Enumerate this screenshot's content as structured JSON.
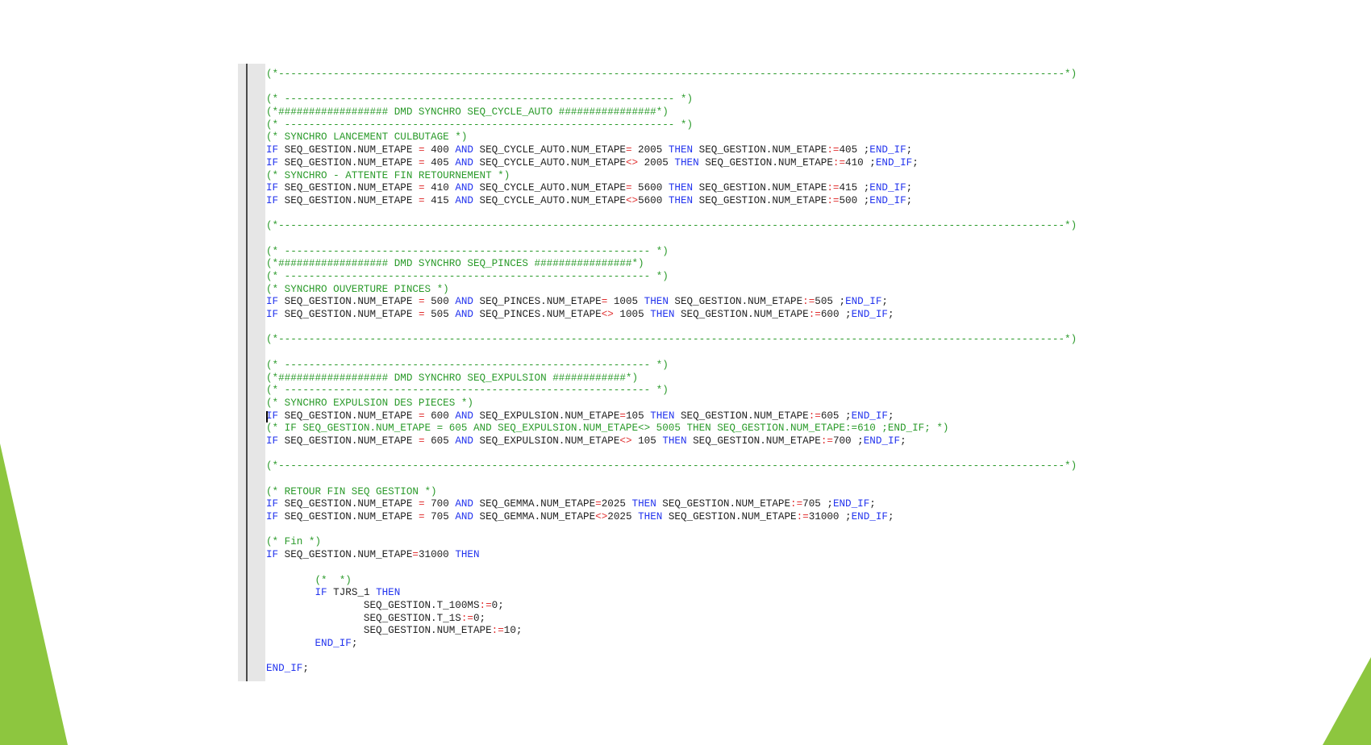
{
  "colors": {
    "comment": "#2a9a2a",
    "keyword": "#2233ee",
    "operator": "#e03030",
    "text": "#222222",
    "gutter": "#e6e6e6",
    "slide_accent_green": "#8dc63f"
  },
  "code_lines": [
    [
      [
        "cmt",
        "(*---------------------------------------------------------------------------------------------------------------------------------*)"
      ]
    ],
    [],
    [
      [
        "cmt",
        "(* ---------------------------------------------------------------- *)"
      ]
    ],
    [
      [
        "cmt",
        "(*################## DMD SYNCHRO SEQ_CYCLE_AUTO ################*)"
      ]
    ],
    [
      [
        "cmt",
        "(* ---------------------------------------------------------------- *)"
      ]
    ],
    [
      [
        "cmt",
        "(* SYNCHRO LANCEMENT CULBUTAGE *)"
      ]
    ],
    [
      [
        "kw",
        "IF"
      ],
      [
        "txt",
        " SEQ_GESTION.NUM_ETAPE "
      ],
      [
        "op",
        "="
      ],
      [
        "txt",
        " 400 "
      ],
      [
        "kw",
        "AND"
      ],
      [
        "txt",
        " SEQ_CYCLE_AUTO.NUM_ETAPE"
      ],
      [
        "op",
        "="
      ],
      [
        "txt",
        " 2005 "
      ],
      [
        "kw",
        "THEN"
      ],
      [
        "txt",
        " SEQ_GESTION.NUM_ETAPE"
      ],
      [
        "op",
        ":="
      ],
      [
        "txt",
        "405 ;"
      ],
      [
        "kw",
        "END_IF"
      ],
      [
        "txt",
        ";"
      ]
    ],
    [
      [
        "kw",
        "IF"
      ],
      [
        "txt",
        " SEQ_GESTION.NUM_ETAPE "
      ],
      [
        "op",
        "="
      ],
      [
        "txt",
        " 405 "
      ],
      [
        "kw",
        "AND"
      ],
      [
        "txt",
        " SEQ_CYCLE_AUTO.NUM_ETAPE"
      ],
      [
        "op",
        "<>"
      ],
      [
        "txt",
        " 2005 "
      ],
      [
        "kw",
        "THEN"
      ],
      [
        "txt",
        " SEQ_GESTION.NUM_ETAPE"
      ],
      [
        "op",
        ":="
      ],
      [
        "txt",
        "410 ;"
      ],
      [
        "kw",
        "END_IF"
      ],
      [
        "txt",
        ";"
      ]
    ],
    [
      [
        "cmt",
        "(* SYNCHRO - ATTENTE FIN RETOURNEMENT *)"
      ]
    ],
    [
      [
        "kw",
        "IF"
      ],
      [
        "txt",
        " SEQ_GESTION.NUM_ETAPE "
      ],
      [
        "op",
        "="
      ],
      [
        "txt",
        " 410 "
      ],
      [
        "kw",
        "AND"
      ],
      [
        "txt",
        " SEQ_CYCLE_AUTO.NUM_ETAPE"
      ],
      [
        "op",
        "="
      ],
      [
        "txt",
        " 5600 "
      ],
      [
        "kw",
        "THEN"
      ],
      [
        "txt",
        " SEQ_GESTION.NUM_ETAPE"
      ],
      [
        "op",
        ":="
      ],
      [
        "txt",
        "415 ;"
      ],
      [
        "kw",
        "END_IF"
      ],
      [
        "txt",
        ";"
      ]
    ],
    [
      [
        "kw",
        "IF"
      ],
      [
        "txt",
        " SEQ_GESTION.NUM_ETAPE "
      ],
      [
        "op",
        "="
      ],
      [
        "txt",
        " 415 "
      ],
      [
        "kw",
        "AND"
      ],
      [
        "txt",
        " SEQ_CYCLE_AUTO.NUM_ETAPE"
      ],
      [
        "op",
        "<>"
      ],
      [
        "txt",
        "5600 "
      ],
      [
        "kw",
        "THEN"
      ],
      [
        "txt",
        " SEQ_GESTION.NUM_ETAPE"
      ],
      [
        "op",
        ":="
      ],
      [
        "txt",
        "500 ;"
      ],
      [
        "kw",
        "END_IF"
      ],
      [
        "txt",
        ";"
      ]
    ],
    [],
    [
      [
        "cmt",
        "(*---------------------------------------------------------------------------------------------------------------------------------*)"
      ]
    ],
    [],
    [
      [
        "cmt",
        "(* ------------------------------------------------------------ *)"
      ]
    ],
    [
      [
        "cmt",
        "(*################## DMD SYNCHRO SEQ_PINCES ################*)"
      ]
    ],
    [
      [
        "cmt",
        "(* ------------------------------------------------------------ *)"
      ]
    ],
    [
      [
        "cmt",
        "(* SYNCHRO OUVERTURE PINCES *)"
      ]
    ],
    [
      [
        "kw",
        "IF"
      ],
      [
        "txt",
        " SEQ_GESTION.NUM_ETAPE "
      ],
      [
        "op",
        "="
      ],
      [
        "txt",
        " 500 "
      ],
      [
        "kw",
        "AND"
      ],
      [
        "txt",
        " SEQ_PINCES.NUM_ETAPE"
      ],
      [
        "op",
        "="
      ],
      [
        "txt",
        " 1005 "
      ],
      [
        "kw",
        "THEN"
      ],
      [
        "txt",
        " SEQ_GESTION.NUM_ETAPE"
      ],
      [
        "op",
        ":="
      ],
      [
        "txt",
        "505 ;"
      ],
      [
        "kw",
        "END_IF"
      ],
      [
        "txt",
        ";"
      ]
    ],
    [
      [
        "kw",
        "IF"
      ],
      [
        "txt",
        " SEQ_GESTION.NUM_ETAPE "
      ],
      [
        "op",
        "="
      ],
      [
        "txt",
        " 505 "
      ],
      [
        "kw",
        "AND"
      ],
      [
        "txt",
        " SEQ_PINCES.NUM_ETAPE"
      ],
      [
        "op",
        "<>"
      ],
      [
        "txt",
        " 1005 "
      ],
      [
        "kw",
        "THEN"
      ],
      [
        "txt",
        " SEQ_GESTION.NUM_ETAPE"
      ],
      [
        "op",
        ":="
      ],
      [
        "txt",
        "600 ;"
      ],
      [
        "kw",
        "END_IF"
      ],
      [
        "txt",
        ";"
      ]
    ],
    [],
    [
      [
        "cmt",
        "(*---------------------------------------------------------------------------------------------------------------------------------*)"
      ]
    ],
    [],
    [
      [
        "cmt",
        "(* ------------------------------------------------------------ *)"
      ]
    ],
    [
      [
        "cmt",
        "(*################## DMD SYNCHRO SEQ_EXPULSION ############*)"
      ]
    ],
    [
      [
        "cmt",
        "(* ------------------------------------------------------------ *)"
      ]
    ],
    [
      [
        "cmt",
        "(* SYNCHRO EXPULSION DES PIECES *)"
      ]
    ],
    [
      [
        "kw",
        "IF"
      ],
      [
        "txt",
        " SEQ_GESTION.NUM_ETAPE "
      ],
      [
        "op",
        "="
      ],
      [
        "txt",
        " 600 "
      ],
      [
        "kw",
        "AND"
      ],
      [
        "txt",
        " SEQ_EXPULSION.NUM_ETAPE"
      ],
      [
        "op",
        "="
      ],
      [
        "txt",
        "105 "
      ],
      [
        "kw",
        "THEN"
      ],
      [
        "txt",
        " SEQ_GESTION.NUM_ETAPE"
      ],
      [
        "op",
        ":="
      ],
      [
        "txt",
        "605 ;"
      ],
      [
        "kw",
        "END_IF"
      ],
      [
        "txt",
        ";"
      ]
    ],
    [
      [
        "cmt",
        "(* IF SEQ_GESTION.NUM_ETAPE = 605 AND SEQ_EXPULSION.NUM_ETAPE<> 5005 THEN SEQ_GESTION.NUM_ETAPE:=610 ;END_IF; *)"
      ]
    ],
    [
      [
        "kw",
        "IF"
      ],
      [
        "txt",
        " SEQ_GESTION.NUM_ETAPE "
      ],
      [
        "op",
        "="
      ],
      [
        "txt",
        " 605 "
      ],
      [
        "kw",
        "AND"
      ],
      [
        "txt",
        " SEQ_EXPULSION.NUM_ETAPE"
      ],
      [
        "op",
        "<>"
      ],
      [
        "txt",
        " 105 "
      ],
      [
        "kw",
        "THEN"
      ],
      [
        "txt",
        " SEQ_GESTION.NUM_ETAPE"
      ],
      [
        "op",
        ":="
      ],
      [
        "txt",
        "700 ;"
      ],
      [
        "kw",
        "END_IF"
      ],
      [
        "txt",
        ";"
      ]
    ],
    [],
    [
      [
        "cmt",
        "(*---------------------------------------------------------------------------------------------------------------------------------*)"
      ]
    ],
    [],
    [
      [
        "cmt",
        "(* RETOUR FIN SEQ GESTION *)"
      ]
    ],
    [
      [
        "kw",
        "IF"
      ],
      [
        "txt",
        " SEQ_GESTION.NUM_ETAPE "
      ],
      [
        "op",
        "="
      ],
      [
        "txt",
        " 700 "
      ],
      [
        "kw",
        "AND"
      ],
      [
        "txt",
        " SEQ_GEMMA.NUM_ETAPE"
      ],
      [
        "op",
        "="
      ],
      [
        "txt",
        "2025 "
      ],
      [
        "kw",
        "THEN"
      ],
      [
        "txt",
        " SEQ_GESTION.NUM_ETAPE"
      ],
      [
        "op",
        ":="
      ],
      [
        "txt",
        "705 ;"
      ],
      [
        "kw",
        "END_IF"
      ],
      [
        "txt",
        ";"
      ]
    ],
    [
      [
        "kw",
        "IF"
      ],
      [
        "txt",
        " SEQ_GESTION.NUM_ETAPE "
      ],
      [
        "op",
        "="
      ],
      [
        "txt",
        " 705 "
      ],
      [
        "kw",
        "AND"
      ],
      [
        "txt",
        " SEQ_GEMMA.NUM_ETAPE"
      ],
      [
        "op",
        "<>"
      ],
      [
        "txt",
        "2025 "
      ],
      [
        "kw",
        "THEN"
      ],
      [
        "txt",
        " SEQ_GESTION.NUM_ETAPE"
      ],
      [
        "op",
        ":="
      ],
      [
        "txt",
        "31000 ;"
      ],
      [
        "kw",
        "END_IF"
      ],
      [
        "txt",
        ";"
      ]
    ],
    [],
    [
      [
        "cmt",
        "(* Fin *)"
      ]
    ],
    [
      [
        "kw",
        "IF"
      ],
      [
        "txt",
        " SEQ_GESTION.NUM_ETAPE"
      ],
      [
        "op",
        "="
      ],
      [
        "txt",
        "31000 "
      ],
      [
        "kw",
        "THEN"
      ]
    ],
    [],
    [
      [
        "txt",
        "        "
      ],
      [
        "cmt",
        "(*  *)"
      ]
    ],
    [
      [
        "txt",
        "        "
      ],
      [
        "kw",
        "IF"
      ],
      [
        "txt",
        " TJRS_1 "
      ],
      [
        "kw",
        "THEN"
      ]
    ],
    [
      [
        "txt",
        "                SEQ_GESTION.T_100MS"
      ],
      [
        "op",
        ":="
      ],
      [
        "txt",
        "0;"
      ]
    ],
    [
      [
        "txt",
        "                SEQ_GESTION.T_1S"
      ],
      [
        "op",
        ":="
      ],
      [
        "txt",
        "0;"
      ]
    ],
    [
      [
        "txt",
        "                SEQ_GESTION.NUM_ETAPE"
      ],
      [
        "op",
        ":="
      ],
      [
        "txt",
        "10;"
      ]
    ],
    [
      [
        "txt",
        "        "
      ],
      [
        "kw",
        "END_IF"
      ],
      [
        "txt",
        ";"
      ]
    ],
    [],
    [
      [
        "kw",
        "END_IF"
      ],
      [
        "txt",
        ";"
      ]
    ]
  ]
}
